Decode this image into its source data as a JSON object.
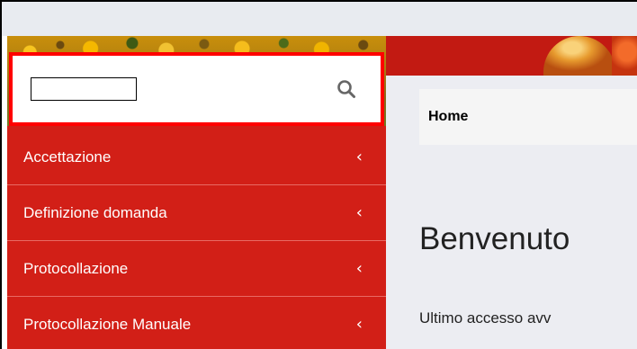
{
  "search": {
    "value": "",
    "icon": "search-icon"
  },
  "sidebar": {
    "items": [
      {
        "label": "Accettazione",
        "icon": "chevron-left-icon",
        "chevron": "‹"
      },
      {
        "label": "Definizione domanda",
        "icon": "chevron-left-icon",
        "chevron": "‹"
      },
      {
        "label": "Protocollazione",
        "icon": "chevron-left-icon",
        "chevron": "‹"
      },
      {
        "label": "Protocollazione Manuale",
        "icon": "chevron-left-icon",
        "chevron": "‹"
      }
    ]
  },
  "breadcrumb": {
    "home": "Home"
  },
  "main": {
    "title": "Benvenuto",
    "last_access": "Ultimo accesso avv"
  },
  "colors": {
    "sidebar_bg": "#d21f17",
    "highlight_border": "#ff0000",
    "main_bg": "#ecedf2"
  }
}
